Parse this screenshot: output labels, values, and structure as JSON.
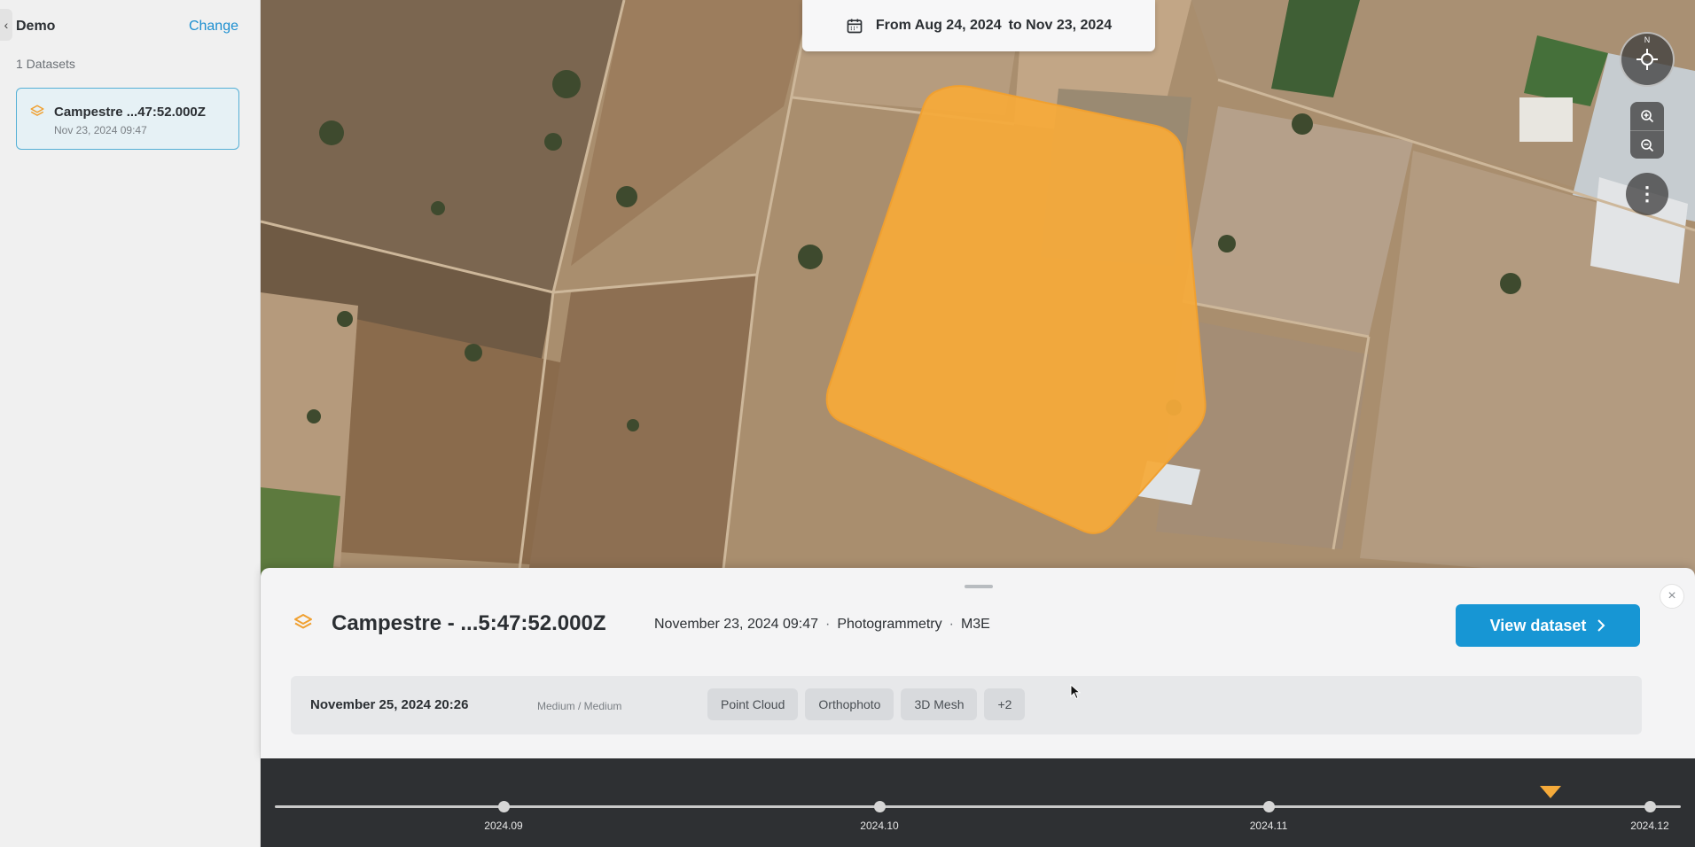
{
  "sidebar": {
    "project_name": "Demo",
    "change_label": "Change",
    "datasets_count": "1 Datasets",
    "datasets": [
      {
        "title": "Campestre ...47:52.000Z",
        "date": "Nov 23, 2024 09:47",
        "icon": "layers-icon"
      }
    ]
  },
  "date_filter": {
    "from": "From Aug 24, 2024",
    "to": "to Nov 23, 2024",
    "icon": "calendar-icon"
  },
  "map_controls": {
    "compass_label": "N",
    "zoom_in_icon": "zoom-in-icon",
    "zoom_out_icon": "zoom-out-icon",
    "more_label": "⋮"
  },
  "detail_panel": {
    "title": "Campestre - ...5:47:52.000Z",
    "captured": "November 23, 2024 09:47",
    "type": "Photogrammetry",
    "sensor": "M3E",
    "separator": "·",
    "view_button": "View dataset",
    "close_label": "×",
    "job": {
      "date": "November 25, 2024 20:26",
      "quality": "Medium / Medium",
      "outputs": [
        "Point Cloud",
        "Orthophoto",
        "3D Mesh",
        "+2"
      ]
    }
  },
  "timeline": {
    "ticks": [
      {
        "label": "2024.09"
      },
      {
        "label": "2024.10"
      },
      {
        "label": "2024.11"
      },
      {
        "label": "2024.12"
      }
    ]
  },
  "colors": {
    "accent": "#1796d4",
    "polygon_fill": "#f5aa3a",
    "selected_card": "#e6f1f5"
  }
}
